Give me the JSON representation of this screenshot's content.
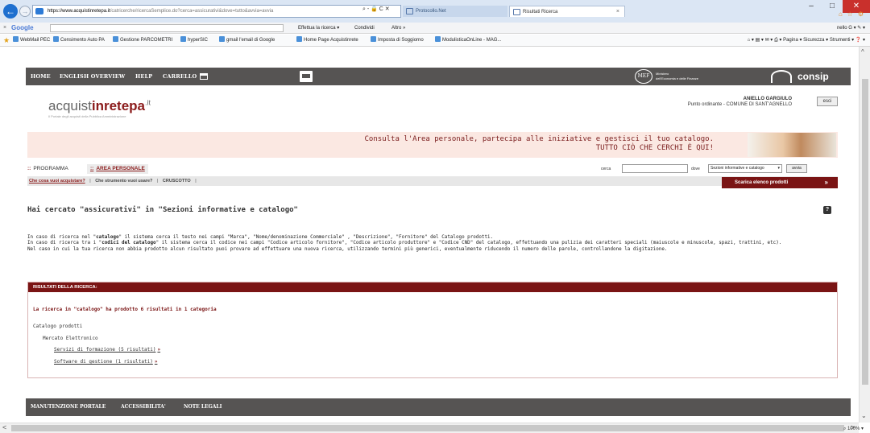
{
  "browser": {
    "url_host": "https://www.acquistinretepa.it",
    "url_path": "/catricerche/ricercaSemplice.do?cerca=assicurativi&dove=tutto&avvia=avvia",
    "url_tail": "⌕ - 🔒 C ✕",
    "tabs": [
      {
        "label": "Protocollo.Net"
      },
      {
        "label": "Risultati Ricerca"
      }
    ],
    "tab_close": "×",
    "window_controls": [
      "–",
      "□",
      "✕"
    ],
    "right_icons": [
      "⌂",
      "☆",
      "⚙"
    ]
  },
  "google_bar": {
    "close": "×",
    "brand": "Google",
    "search_label": "Effettua la ricerca ▾",
    "share_label": "Condividi",
    "more_label": "Altro »",
    "account": "nello G ▾  ✎ ▾"
  },
  "favorites": {
    "star": "★",
    "items": [
      "WebMail PEC",
      "Censimento Auto PA",
      "Gestione PARCOMETRI",
      "hyperSIC",
      "gmail l'email di Google",
      "Home Page Acquistinrete",
      "Imposta di Soggiorno",
      "ModulisticaOnLine - MAG..."
    ],
    "toolbar": "⌂ ▾  ▤ ▾  ✉ ▾  ⎙ ▾  Pagina ▾  Sicurezza ▾  Strumenti ▾  ❓ ▾"
  },
  "site_nav": {
    "home": "HOME",
    "english": "ENGLISH OVERVIEW",
    "help": "HELP",
    "carrello": "CARRELLO",
    "mef": "MEF",
    "mef_text_1": "Ministero",
    "mef_text_2": "dell'Economia e delle Finanze",
    "consip": "consip"
  },
  "logo": {
    "part1": "acquist",
    "part2": "inrete",
    "part3": "pa",
    "sup": ".it",
    "subtitle": "Il Portale degli acquisti della Pubblica Amministrazione"
  },
  "user": {
    "name": "ANIELLO GARGIULO",
    "role": "Punto ordinante - COMUNE DI SANT'AGNELLO",
    "logout": "esci"
  },
  "banner": {
    "line1": "Consulta l'Area personale, partecipa alle iniziative e gestisci il tuo catalogo.",
    "line2": "TUTTO CIÒ CHE CERCHI È QUI!"
  },
  "tabs_row": {
    "bullet": "::",
    "programma": "PROGRAMMA",
    "area": "AREA PERSONALE"
  },
  "search": {
    "cerca_label": "cerca",
    "value": "",
    "dove_label": "dove",
    "dove_value": "Sezioni informative e catalogo",
    "chevron": "▾",
    "button": "avvia"
  },
  "sublinks": {
    "link1": "Che cosa vuoi acquistare?",
    "sep": "|",
    "link2": "Che strumento vuoi usare?",
    "link3": "CRUSCOTTO",
    "scarica": "Scarica elenco prodotti",
    "scarica_chev": "»"
  },
  "heading": {
    "title": "Hai cercato \"assicurativi\" in \"Sezioni informative e catalogo\"",
    "help": "?"
  },
  "info": {
    "p1_a": "In caso di ricerca nel \"",
    "p1_b": "catalogo",
    "p1_c": "\" il sistema cerca il testo nei campi \"Marca\", \"Nome/denominazione Commerciale\" , \"Descrizione\", \"Fornitore\" del Catalogo prodotti.",
    "p2_a": "In caso di ricerca tra i \"",
    "p2_b": "codici del catalogo",
    "p2_c": "\" il sistema cerca il codice nei campi \"Codice articolo fornitore\", \"Codice articolo produttore\" e \"Codice CND\" del catalogo, effettuando una pulizia dei caratteri speciali (maiuscole e minuscole, spazi, trattini, etc).",
    "p3": "Nel caso in cui la tua ricerca non abbia prodotto alcun risultato puoi provare ad effettuare una nuova ricerca, utilizzando termini più generici, eventualmente riducendo il numero delle parole, controllandone la digitazione."
  },
  "results": {
    "header": "RISULTATI DELLA RICERCA:",
    "summary": "La ricerca in \"catalogo\" ha prodotto 6 risultati in 1 categoria",
    "catalog": "Catalogo prodotti",
    "market": "Mercato Elettronico",
    "items": [
      {
        "label": "Servizi di formazione (5 risultati)"
      },
      {
        "label": "Software di gestione (1 risultati)"
      }
    ],
    "arrow": "»"
  },
  "footer": {
    "manutenzione": "MANUTENZIONE PORTALE",
    "accessibilita": "ACCESSIBILITA'",
    "note": "NOTE LEGALI"
  },
  "status": {
    "zoom": "⌕ 100%  ▾"
  }
}
